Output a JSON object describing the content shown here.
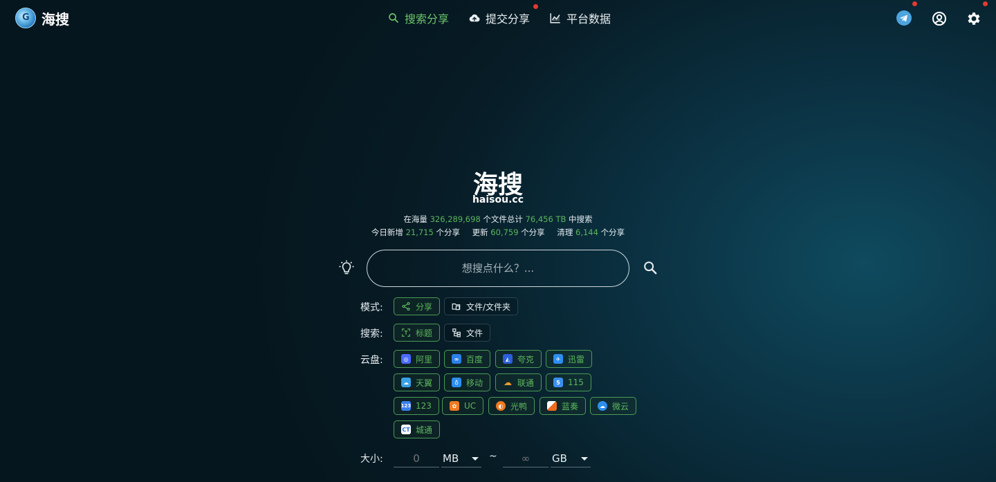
{
  "header": {
    "logo_text": "海搜",
    "nav": [
      {
        "label": "搜索分享",
        "icon": "search-icon",
        "active": true
      },
      {
        "label": "提交分享",
        "icon": "cloud-upload-icon",
        "badge": true
      },
      {
        "label": "平台数据",
        "icon": "chart-icon"
      }
    ],
    "icons": [
      "telegram-icon",
      "account-icon",
      "settings-icon"
    ]
  },
  "hero": {
    "title": "海搜",
    "domain": "haisou.cc",
    "stats1": {
      "pre": "在海量",
      "files": "326,289,698",
      "mid": "个文件总计",
      "size": "76,456 TB",
      "post": "中搜索"
    },
    "stats2": {
      "today_label": "今日新增",
      "today": "21,715",
      "today_unit": "个分享",
      "update_label": "更新",
      "update": "60,759",
      "update_unit": "个分享",
      "clean_label": "清理",
      "clean": "6,144",
      "clean_unit": "个分享"
    }
  },
  "search": {
    "placeholder": "想搜点什么？..."
  },
  "filters": {
    "mode_label": "模式:",
    "mode_options": [
      "分享",
      "文件/文件夹"
    ],
    "search_label": "搜索:",
    "search_options": [
      "标题",
      "文件"
    ],
    "cloud_label": "云盘:",
    "clouds": [
      "阿里",
      "百度",
      "夸克",
      "迅雷",
      "天翼",
      "移动",
      "联通",
      "115",
      "123",
      "UC",
      "光鸭",
      "蓝奏",
      "微云",
      "城通"
    ],
    "size_label": "大小:",
    "size_min_placeholder": "0",
    "size_min_unit": "MB",
    "size_sep": "~",
    "size_max_placeholder": "∞",
    "size_max_unit": "GB"
  },
  "colors": {
    "accent": "#5cb65c",
    "badge": "#e33a2f",
    "bg": "#071c26"
  }
}
